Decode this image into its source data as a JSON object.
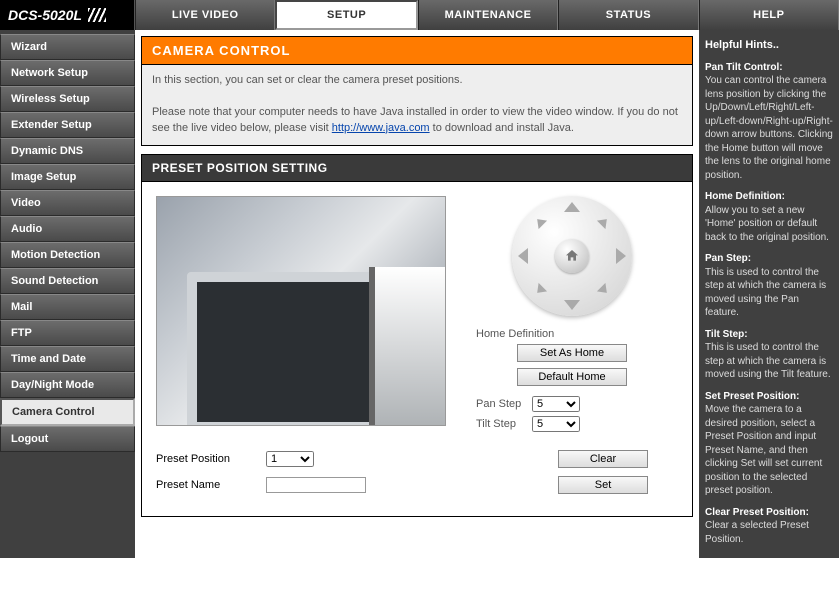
{
  "brand": "DCS-5020L",
  "topnav": {
    "live": "LIVE VIDEO",
    "setup": "SETUP",
    "maint": "MAINTENANCE",
    "status": "STATUS",
    "help": "HELP"
  },
  "sidebar": {
    "wizard": "Wizard",
    "network": "Network Setup",
    "wireless": "Wireless Setup",
    "extender": "Extender Setup",
    "ddns": "Dynamic DNS",
    "image": "Image Setup",
    "video": "Video",
    "audio": "Audio",
    "motion": "Motion Detection",
    "sound": "Sound Detection",
    "mail": "Mail",
    "ftp": "FTP",
    "time": "Time and Date",
    "daynight": "Day/Night Mode",
    "camctrl": "Camera Control",
    "logout": "Logout"
  },
  "main": {
    "cc_header": "CAMERA CONTROL",
    "cc_intro1": "In this section, you can set or clear the camera preset positions.",
    "cc_intro2a": "Please note that your computer needs to have Java installed in order to view the video window. If you do not see the live video below, please visit ",
    "cc_link": "http://www.java.com",
    "cc_intro2b": " to download and install Java.",
    "pps_header": "PRESET POSITION SETTING",
    "home_def": "Home Definition",
    "set_home": "Set As Home",
    "def_home": "Default Home",
    "pan_step": "Pan Step",
    "tilt_step": "Tilt Step",
    "pan_value": "5",
    "tilt_value": "5",
    "preset_pos": "Preset Position",
    "preset_val": "1",
    "preset_name": "Preset Name",
    "preset_name_val": "",
    "clear": "Clear",
    "set": "Set"
  },
  "hints": {
    "title": "Helpful Hints..",
    "s1t": "Pan Tilt Control:",
    "s1b": "You can control the camera lens position by clicking the Up/Down/Left/Right/Left-up/Left-down/Right-up/Right-down arrow buttons. Clicking the Home button will move the lens to the original home position.",
    "s2t": "Home Definition:",
    "s2b": "Allow you to set a new 'Home' position or default back to the original position.",
    "s3t": "Pan Step:",
    "s3b": "This is used to control the step at which the camera is moved using the Pan feature.",
    "s4t": "Tilt Step:",
    "s4b": "This is used to control the step at which the camera is moved using the Tilt feature.",
    "s5t": "Set Preset Position:",
    "s5b": "Move the camera to a desired position, select a Preset Position and input Preset Name, and then clicking Set will set current position to the selected preset position.",
    "s6t": "Clear Preset Position:",
    "s6b": "Clear a selected Preset Position."
  }
}
